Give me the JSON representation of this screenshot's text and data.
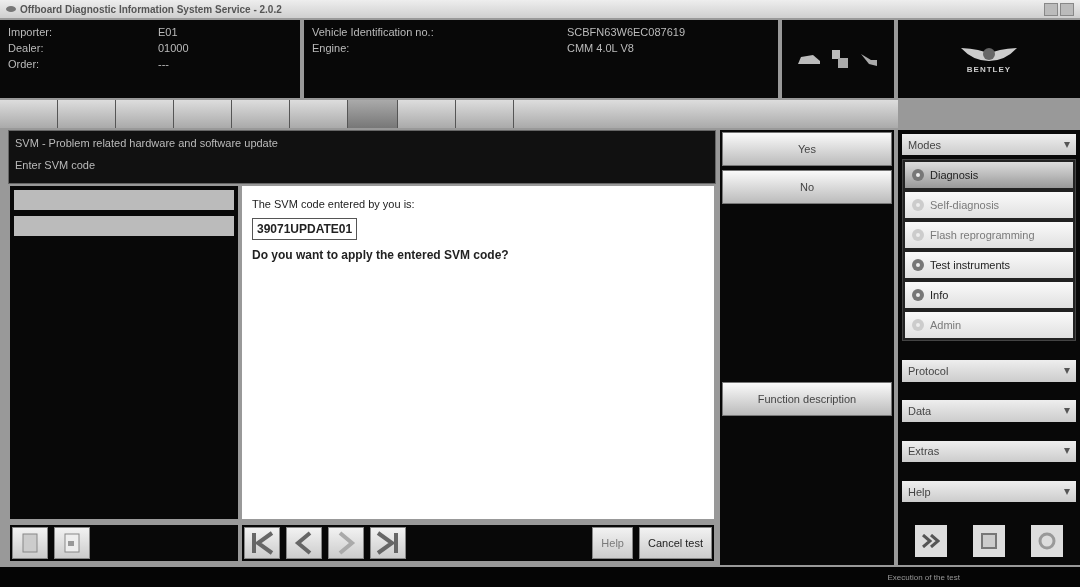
{
  "window": {
    "title": "Offboard Diagnostic Information System Service - 2.0.2"
  },
  "header": {
    "fields": [
      {
        "label": "Importer:",
        "value": "E01"
      },
      {
        "label": "Dealer:",
        "value": "01000"
      },
      {
        "label": "Order:",
        "value": "---"
      }
    ],
    "vehicle": [
      {
        "label": "Vehicle Identification no.:",
        "value": "SCBFN63W6EC087619"
      },
      {
        "label": "Engine:",
        "value": "CMM 4.0L V8"
      }
    ],
    "logo": "BENTLEY"
  },
  "tabs": [
    {
      "selected": false
    },
    {
      "selected": false
    },
    {
      "selected": false
    },
    {
      "selected": false
    },
    {
      "selected": false
    },
    {
      "selected": false
    },
    {
      "selected": true
    },
    {
      "selected": false
    },
    {
      "selected": false
    }
  ],
  "test": {
    "title": "SVM - Problem related hardware and software update",
    "subtitle": "Enter SVM code",
    "steps": [
      {
        "selected": false
      },
      {
        "selected": false
      }
    ],
    "prompt": "The SVM code entered by you is:",
    "code": "39071UPDATE01",
    "question": "Do you want to apply the entered SVM code?"
  },
  "answers": [
    {
      "label": "Yes"
    },
    {
      "label": "No"
    }
  ],
  "function_description": "Function description",
  "bottom_buttons": [
    {
      "label": "Help",
      "disabled": true
    },
    {
      "label": "Cancel test",
      "disabled": false
    }
  ],
  "modes": {
    "title": "Modes",
    "items": [
      {
        "label": "Diagnosis",
        "selected": true,
        "disabled": false
      },
      {
        "label": "Self-diagnosis",
        "selected": false,
        "disabled": true
      },
      {
        "label": "Flash reprogramming",
        "selected": false,
        "disabled": true
      },
      {
        "label": "Test instruments",
        "selected": false,
        "disabled": false
      },
      {
        "label": "Info",
        "selected": false,
        "disabled": false
      },
      {
        "label": "Admin",
        "selected": false,
        "disabled": true
      }
    ]
  },
  "sections": [
    "Protocol",
    "Data",
    "Extras",
    "Help"
  ],
  "status_bar": "Execution of the test"
}
